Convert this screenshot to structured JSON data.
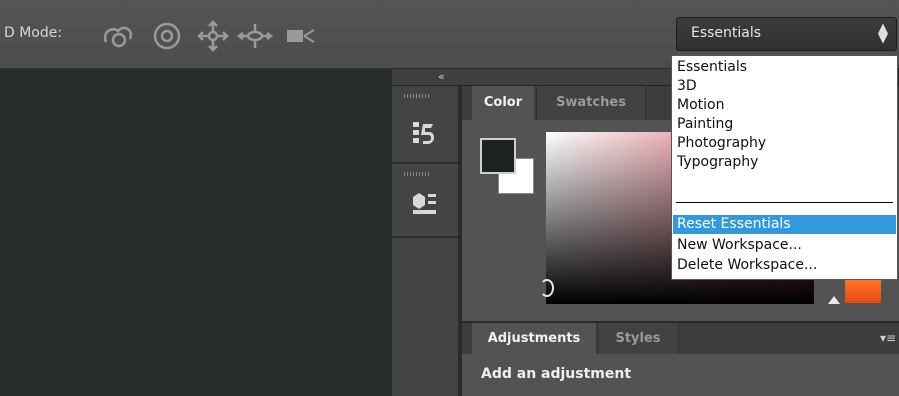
{
  "options_bar": {
    "mode_label": "D Mode:",
    "tools": [
      {
        "icon": "rotate-3d-icon"
      },
      {
        "icon": "roll-3d-icon"
      },
      {
        "icon": "drag-3d-icon"
      },
      {
        "icon": "slide-3d-icon"
      },
      {
        "icon": "scale-3d-icon"
      }
    ]
  },
  "workspace": {
    "selected": "Essentials",
    "arrows": "⬍",
    "menu": {
      "items": [
        "Essentials",
        "3D",
        "Motion",
        "Painting",
        "Photography",
        "Typography"
      ],
      "actions": [
        "Reset Essentials",
        "New Workspace...",
        "Delete Workspace..."
      ],
      "highlighted": "Reset Essentials"
    }
  },
  "dock": {
    "collapse_glyph": "«",
    "icons": [
      "history-icon",
      "3d-panel-icon"
    ]
  },
  "color_panel": {
    "tabs": [
      "Color",
      "Swatches"
    ],
    "active_tab": "Color",
    "foreground_color": "#1c2220",
    "background_color": "#ffffff",
    "spectrum_hue": "#d55a6a",
    "ramp_color": "#ff6a20"
  },
  "adjustments_panel": {
    "tabs": [
      "Adjustments",
      "Styles"
    ],
    "active_tab": "Adjustments",
    "heading": "Add an adjustment",
    "menu_glyph": "▾≡"
  }
}
